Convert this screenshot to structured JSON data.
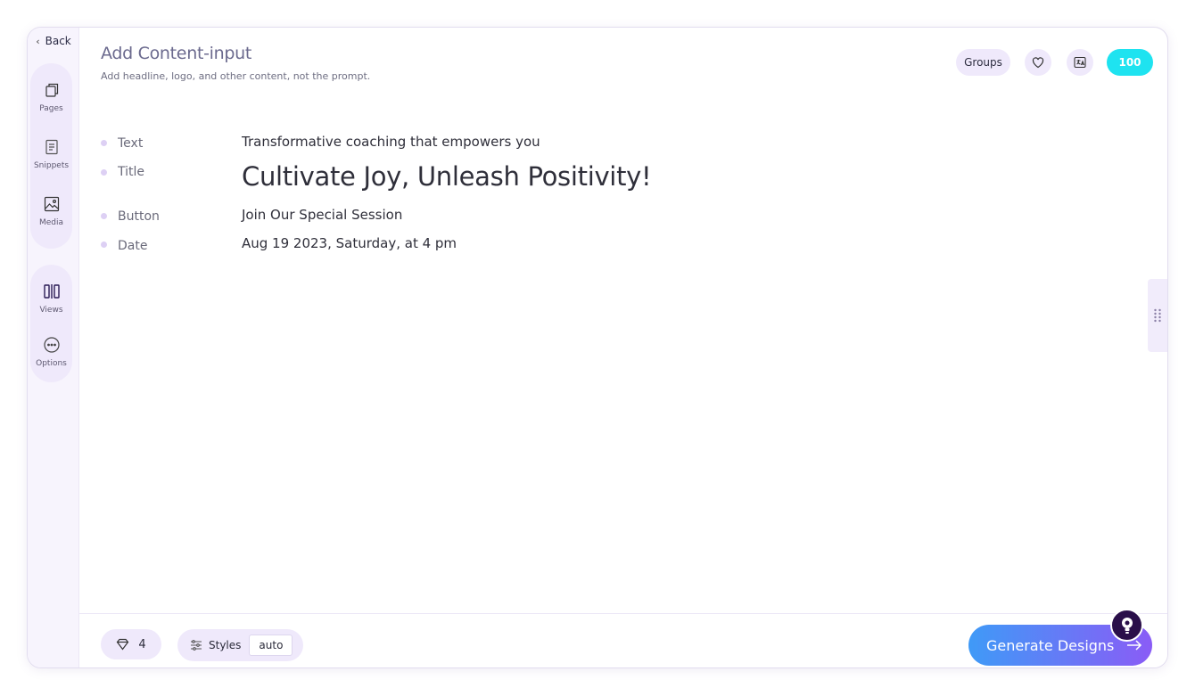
{
  "sidebar": {
    "back_label": "Back",
    "items": [
      {
        "label": "Pages",
        "icon": "pages-icon"
      },
      {
        "label": "Snippets",
        "icon": "snippet-icon"
      },
      {
        "label": "Media",
        "icon": "image-icon"
      },
      {
        "label": "Views",
        "icon": "views-icon"
      },
      {
        "label": "Options",
        "icon": "more-icon"
      }
    ]
  },
  "header": {
    "title": "Add Content-input",
    "subtitle": "Add headline, logo, and other content, not the prompt.",
    "groups_label": "Groups",
    "credits": "100"
  },
  "content": {
    "rows": [
      {
        "key": "Text",
        "value": "Transformative coaching that empowers you"
      },
      {
        "key": "Title",
        "value": "Cultivate Joy, Unleash Positivity!"
      },
      {
        "key": "Button",
        "value": "Join Our Special Session"
      },
      {
        "key": "Date",
        "value": "Aug 19 2023, Saturday, at 4 pm"
      }
    ]
  },
  "footer": {
    "gem_count": "4",
    "styles_label": "Styles",
    "styles_value": "auto",
    "generate_label": "Generate Designs"
  },
  "colors": {
    "accent": "#8a5cf6",
    "credits_bg": "#1ee3f0",
    "pill_bg": "#efe9fb"
  }
}
